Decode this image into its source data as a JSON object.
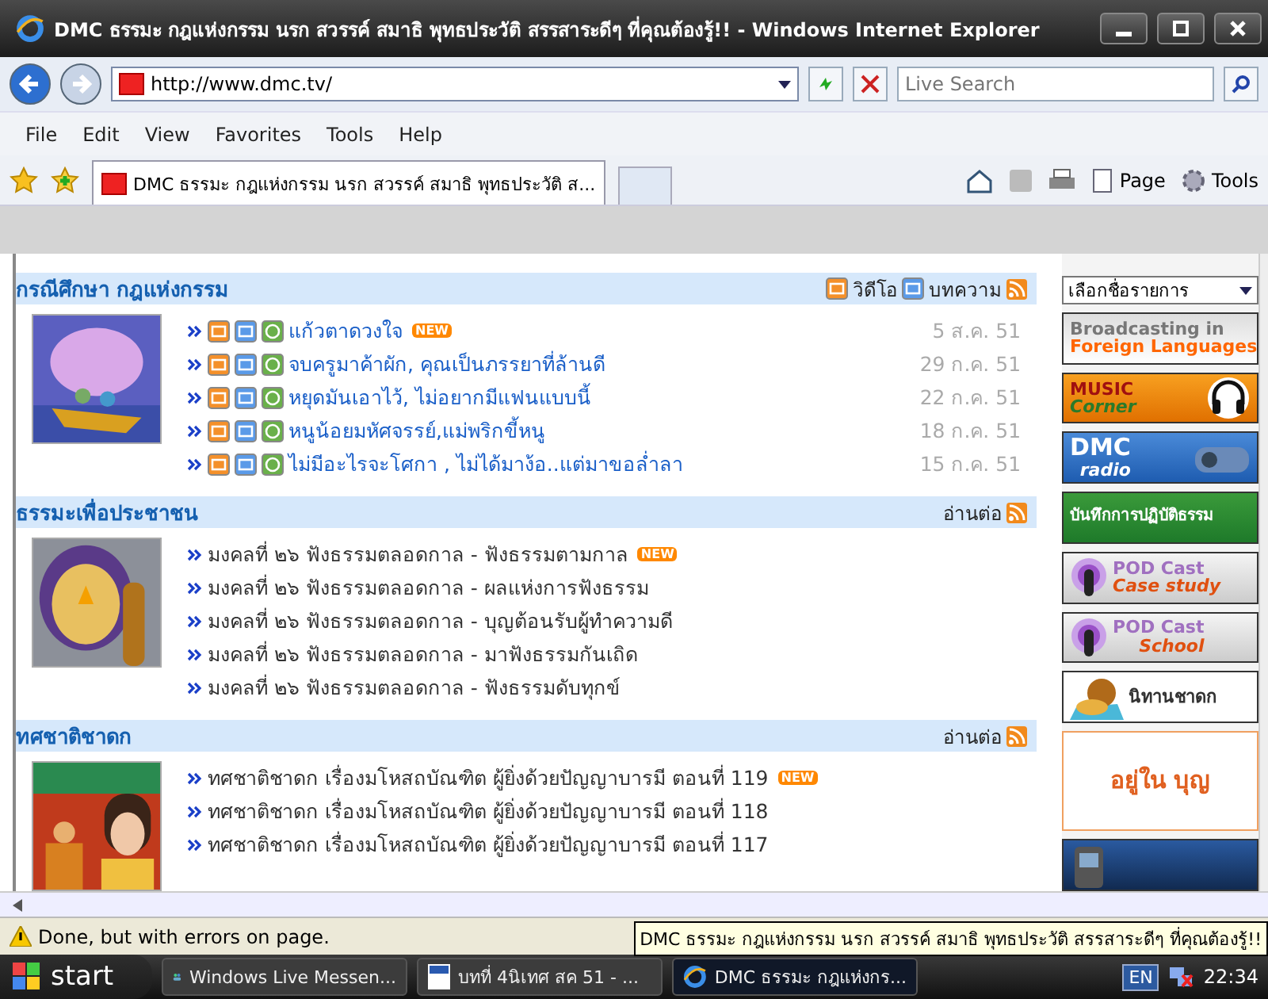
{
  "window": {
    "title": "DMC ธรรมะ กฎแห่งกรรม นรก สวรรค์ สมาธิ พุทธประวัติ สรรสาระดีๆ ที่คุณต้องรู้!! - Windows Internet Explorer"
  },
  "address": {
    "value": "http://www.dmc.tv/"
  },
  "search": {
    "placeholder": "Live Search"
  },
  "menu": [
    "File",
    "Edit",
    "View",
    "Favorites",
    "Tools",
    "Help"
  ],
  "tab": {
    "title": "DMC ธรรมะ กฎแห่งกรรม นรก สวรรค์ สมาธิ พุทธประวัติ ส..."
  },
  "toolbar": [
    "Page",
    "Tools"
  ],
  "sections": [
    {
      "title": "กรณีศึกษา กฎแห่งกรรม",
      "links": [
        {
          "label": "วิดีโอ",
          "kind": "video"
        },
        {
          "label": "บทความ",
          "kind": "article"
        }
      ],
      "items": [
        {
          "kind": "media",
          "text": "แก้วตาดวงใจ",
          "badge": "NEW",
          "date": "5 ส.ค. 51"
        },
        {
          "kind": "media",
          "text": "จบครูมาค้าผัก, คุณเป็นภรรยาที่ล้านดี",
          "date": "29 ก.ค. 51"
        },
        {
          "kind": "media",
          "text": "หยุดมันเอาไว้, ไม่อยากมีแฟนแบบนี้",
          "date": "22 ก.ค. 51"
        },
        {
          "kind": "media",
          "text": "หนูน้อยมหัศจรรย์,แม่พริกขี้หนู",
          "date": "18 ก.ค. 51"
        },
        {
          "kind": "media",
          "text": "ไม่มีอะไรจะโศกา , ไม่ได้มาง้อ..แต่มาขอล่ำลา",
          "date": "15 ก.ค. 51"
        }
      ]
    },
    {
      "title": "ธรรมะเพื่อประชาชน",
      "links": [
        {
          "label": "อ่านต่อ",
          "kind": "more"
        }
      ],
      "items": [
        {
          "kind": "text",
          "text": "มงคลที่ ๒๖ ฟังธรรมตลอดกาล - ฟังธรรมตามกาล",
          "badge": "NEW"
        },
        {
          "kind": "text",
          "text": "มงคลที่ ๒๖ ฟังธรรมตลอดกาล - ผลแห่งการฟังธรรม"
        },
        {
          "kind": "text",
          "text": "มงคลที่ ๒๖ ฟังธรรมตลอดกาล - บุญต้อนรับผู้ทำความดี"
        },
        {
          "kind": "text",
          "text": "มงคลที่ ๒๖ ฟังธรรมตลอดกาล - มาฟังธรรมกันเถิด"
        },
        {
          "kind": "text",
          "text": "มงคลที่ ๒๖ ฟังธรรมตลอดกาล - ฟังธรรมดับทุกข์"
        }
      ]
    },
    {
      "title": "ทศชาติชาดก",
      "links": [
        {
          "label": "อ่านต่อ",
          "kind": "more"
        }
      ],
      "items": [
        {
          "kind": "text",
          "text": "ทศชาติชาดก เรื่องมโหสถบัณฑิต ผู้ยิ่งด้วยปัญญาบารมี ตอนที่ 119",
          "badge": "NEW"
        },
        {
          "kind": "text",
          "text": "ทศชาติชาดก เรื่องมโหสถบัณฑิต ผู้ยิ่งด้วยปัญญาบารมี ตอนที่ 118"
        },
        {
          "kind": "text",
          "text": "ทศชาติชาดก เรื่องมโหสถบัณฑิต ผู้ยิ่งด้วยปัญญาบารมี ตอนที่ 117"
        }
      ]
    }
  ],
  "sidebar": {
    "select": "เลือกชื่อรายการ",
    "banners": [
      {
        "kind": "foreign",
        "lines": [
          "Broadcasting in",
          "Foreign Languages"
        ]
      },
      {
        "kind": "music",
        "lines": [
          "MUSIC",
          "Corner"
        ]
      },
      {
        "kind": "radio",
        "lines": [
          "DMC",
          "radio"
        ]
      },
      {
        "kind": "green",
        "lines": [
          "บันทึกการปฏิบัติธรรม"
        ]
      },
      {
        "kind": "pod",
        "lines": [
          "POD Cast",
          "Case study"
        ]
      },
      {
        "kind": "pod",
        "lines": [
          "POD Cast",
          "School"
        ]
      },
      {
        "kind": "tale",
        "lines": [
          "นิทานชาดก"
        ]
      },
      {
        "kind": "merit",
        "lines": [
          "อยู่ใน บุญ"
        ]
      },
      {
        "kind": "tv"
      }
    ]
  },
  "status": {
    "text": "Done, but with errors on page."
  },
  "tooltip": "DMC ธรรมะ กฎแห่งกรรม นรก สวรรค์ สมาธิ พุทธประวัติ สรรสาระดีๆ ที่คุณต้องรู้!!",
  "taskbar": {
    "start": "start",
    "tasks": [
      {
        "label": "Windows Live Messen...",
        "kind": "messenger",
        "selected": false
      },
      {
        "label": "บทที่ 4นิเทศ สค 51 - ...",
        "kind": "word",
        "selected": false
      },
      {
        "label": "DMC ธรรมะ กฎแห่งกร...",
        "kind": "ie",
        "selected": true
      }
    ],
    "lang": "EN",
    "clock": "22:34"
  }
}
